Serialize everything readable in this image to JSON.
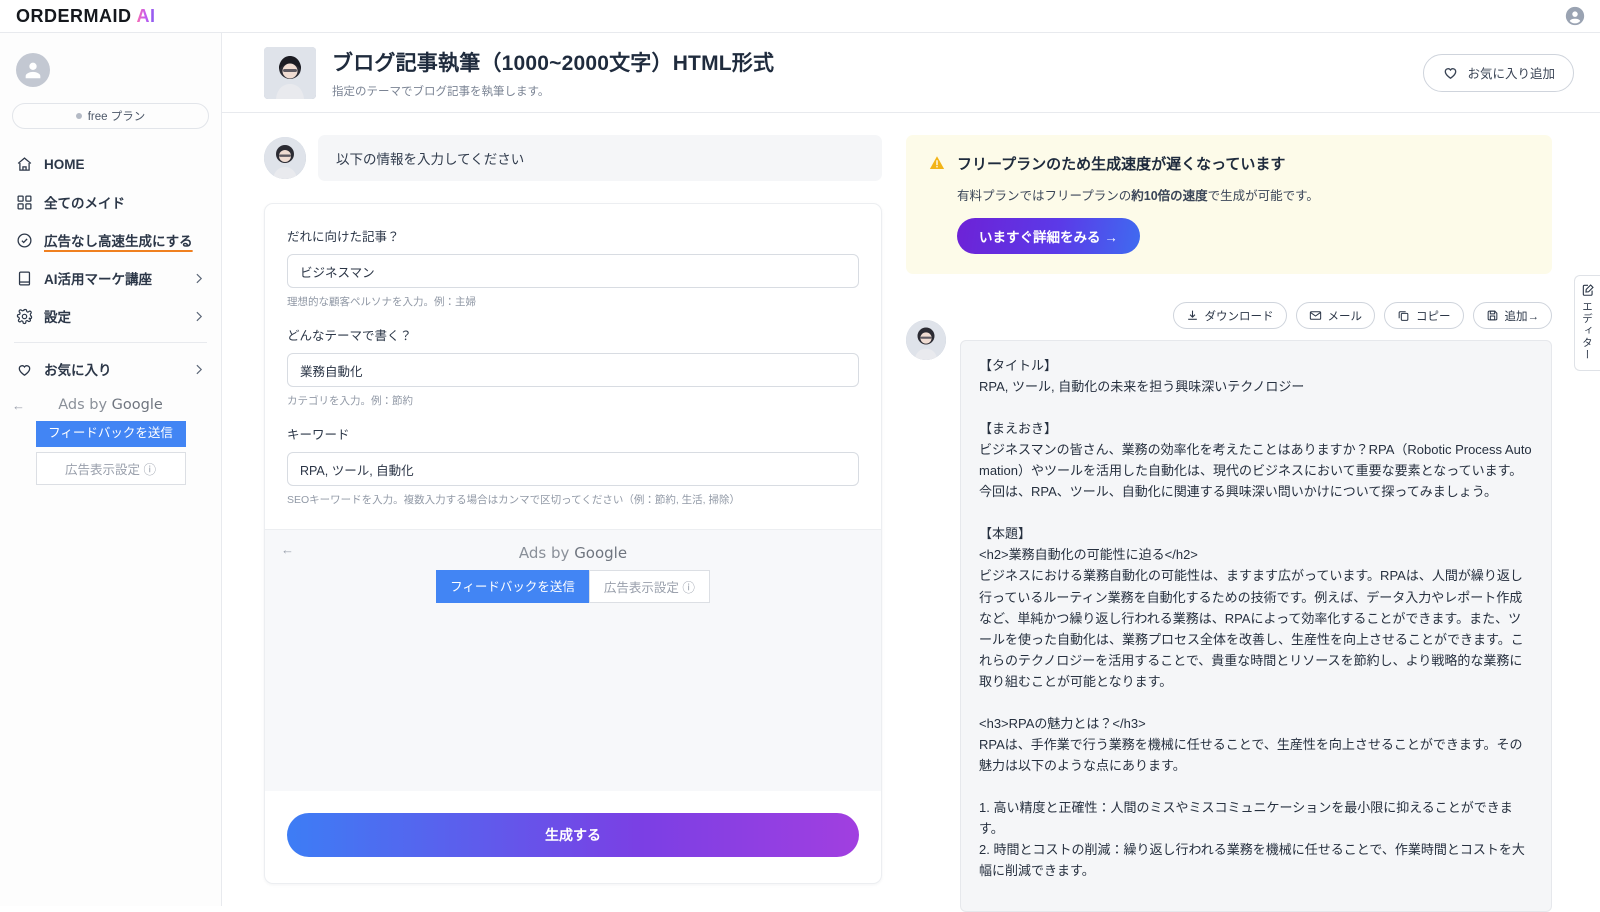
{
  "topbar": {
    "brand_main": "ORDERMAID",
    "brand_ai": "AI",
    "user_icon": "user-circle-icon"
  },
  "sidebar": {
    "plan": {
      "label": "free プラン",
      "dot_color": "#b4bac5"
    },
    "items": [
      {
        "icon": "home-icon",
        "label": "HOME",
        "chevron": false
      },
      {
        "icon": "grid-icon",
        "label": "全てのメイド",
        "chevron": false
      },
      {
        "icon": "check-badge-icon",
        "label": "広告なし高速生成にする",
        "chevron": false,
        "highlight": true
      },
      {
        "icon": "book-icon",
        "label": "AI活用マーケ講座",
        "chevron": true
      },
      {
        "icon": "gear-icon",
        "label": "設定",
        "chevron": true
      }
    ],
    "favorites": {
      "icon": "heart-icon",
      "label": "お気に入り",
      "chevron": true
    },
    "ad": {
      "back_arrow": "←",
      "ads_by_prefix": "Ads by ",
      "ads_by_brand": "Google",
      "feedback_label": "フィードバックを送信",
      "settings_label": "広告表示設定 ⓘ",
      "feedback_color": "#4285f4"
    }
  },
  "header": {
    "thumb": "maid-avatar",
    "title": "ブログ記事執筆（1000~2000文字）HTML形式",
    "subtitle": "指定のテーマでブログ記事を執筆します。",
    "favorite_button": {
      "icon": "heart-icon",
      "label": "お気に入り追加"
    }
  },
  "form": {
    "assistant_prompt": "以下の情報を入力してください",
    "fields": [
      {
        "label": "だれに向けた記事？",
        "value": "ビジネスマン",
        "placeholder": "",
        "hint": "理想的な顧客ペルソナを入力。例：主婦"
      },
      {
        "label": "どんなテーマで書く？",
        "value": "業務自動化",
        "placeholder": "",
        "hint": "カテゴリを入力。例：節約"
      },
      {
        "label": "キーワード",
        "value": "RPA, ツール, 自動化",
        "placeholder": "",
        "hint": "SEOキーワードを入力。複数入力する場合はカンマで区切ってください（例：節約, 生活, 掃除）"
      }
    ],
    "ad": {
      "back_arrow": "←",
      "ads_by_prefix": "Ads by ",
      "ads_by_brand": "Google",
      "feedback_label": "フィードバックを送信",
      "settings_label": "広告表示設定 ⓘ"
    },
    "submit_label": "生成する"
  },
  "warning": {
    "icon": "warning-triangle-icon",
    "title": "フリープランのため生成速度が遅くなっています",
    "body_pre": "有料プランではフリープランの",
    "body_strong": "約10倍の速度",
    "body_post": "で生成が可能です。",
    "cta_label": "いますぐ詳細をみる →",
    "bg_color": "#fdfbe9"
  },
  "result": {
    "actions": [
      {
        "icon": "download-icon",
        "label": "ダウンロード"
      },
      {
        "icon": "mail-icon",
        "label": "メール"
      },
      {
        "icon": "copy-icon",
        "label": "コピー"
      },
      {
        "icon": "save-icon",
        "label": "追加→"
      }
    ],
    "content": "【タイトル】\nRPA, ツール, 自動化の未来を担う興味深いテクノロジー\n\n【まえおき】\nビジネスマンの皆さん、業務の効率化を考えたことはありますか？RPA（Robotic Process Automation）やツールを活用した自動化は、現代のビジネスにおいて重要な要素となっています。今回は、RPA、ツール、自動化に関連する興味深い問いかけについて探ってみましょう。\n\n【本題】\n<h2>業務自動化の可能性に迫る</h2>\nビジネスにおける業務自動化の可能性は、ますます広がっています。RPAは、人間が繰り返し行っているルーティン業務を自動化するための技術です。例えば、データ入力やレポート作成など、単純かつ繰り返し行われる業務は、RPAによって効率化することができます。また、ツールを使った自動化は、業務プロセス全体を改善し、生産性を向上させることができます。これらのテクノロジーを活用することで、貴重な時間とリソースを節約し、より戦略的な業務に取り組むことが可能となります。\n\n<h3>RPAの魅力とは？</h3>\nRPAは、手作業で行う業務を機械に任せることで、生産性を向上させることができます。その魅力は以下のような点にあります。\n\n1. 高い精度と正確性：人間のミスやミスコミュニケーションを最小限に抑えることができます。\n2. 時間とコストの削減：繰り返し行われる業務を機械に任せることで、作業時間とコストを大幅に削減できます。"
  },
  "editor_tab": {
    "icon": "edit-document-icon",
    "label": "エディター"
  }
}
